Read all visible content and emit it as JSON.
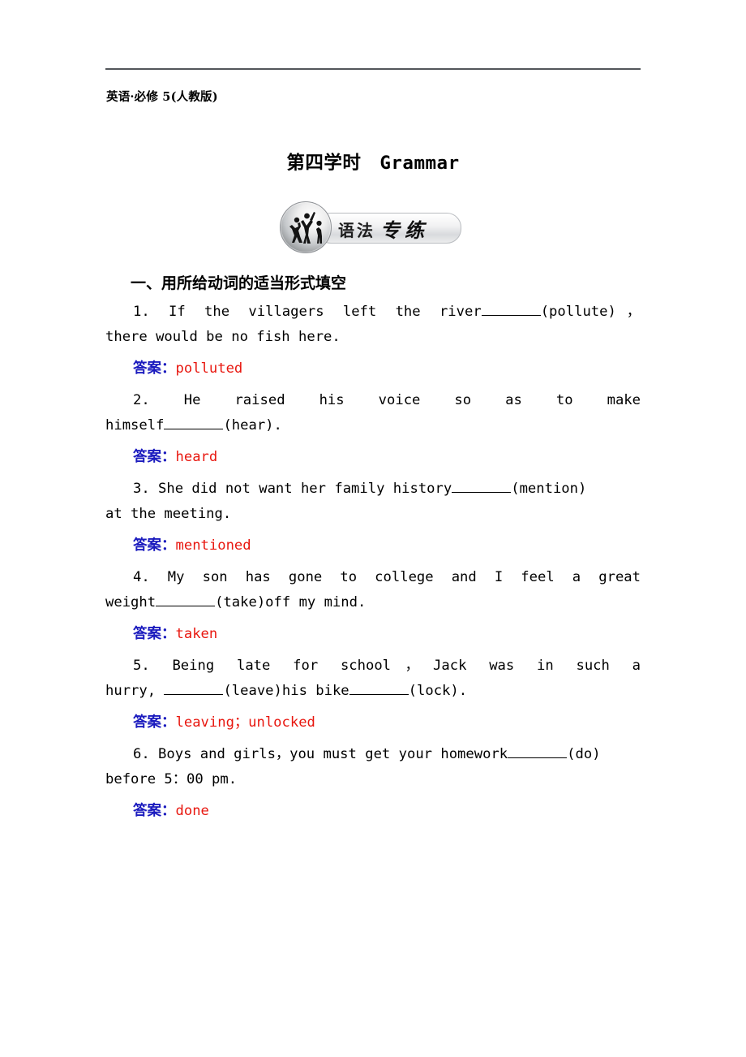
{
  "header": {
    "label": "英语·必修 5(人教版)",
    "rule": "horizontal-rule"
  },
  "title": "第四学时　Grammar",
  "banner": {
    "text_left": "语法",
    "text_right": "专练",
    "logo": "dancers-circle-logo"
  },
  "section": {
    "heading": "一、用所给动词的适当形式填空"
  },
  "colors": {
    "answer_label": "#1b1bbe",
    "answer_value": "#e8170f",
    "rule": "#53565a",
    "text": "#000000"
  },
  "questions": [
    {
      "number": "1.",
      "line1_pre": "1.  If  the  villagers  left  the  river",
      "line1_post": "(pollute)，",
      "line2": "there would be no fish here.",
      "justify": "wide",
      "answer_label": "答案：",
      "answer_value": "polluted"
    },
    {
      "number": "2.",
      "line1_pre": "2. He    raised    his    voice    so    as    to    make",
      "line1_post": "",
      "line2_pre": "himself",
      "line2_post": "(hear).",
      "line2_has_blank": true,
      "justify": "wide",
      "answer_label": "答案：",
      "answer_value": "heard"
    },
    {
      "number": "3.",
      "line1_pre": "3. She did not want her family history",
      "line1_post": "(mention)",
      "line2": "at the meeting.",
      "justify": "tight",
      "answer_label": "答案：",
      "answer_value": "mentioned"
    },
    {
      "number": "4.",
      "line1_pre": "4.  My  son  has  gone  to  college  and  I  feel  a  great",
      "line1_post": "",
      "line2_pre": "weight",
      "line2_post": "(take)off my mind.",
      "line2_has_blank": true,
      "justify": "wide",
      "answer_label": "答案：",
      "answer_value": "taken"
    },
    {
      "number": "5.",
      "line1_pre": "5.  Being  late  for  school，Jack  was  in  such  a",
      "line1_post": "",
      "line2_pre": "hurry, ",
      "line2_mid": "(leave)his bike",
      "line2_post": "(lock).",
      "line2_has_blank": true,
      "line2_two_blanks": true,
      "justify": "wide",
      "answer_label": "答案：",
      "answer_value": "leaving；unlocked"
    },
    {
      "number": "6.",
      "line1_pre": "6. Boys and girls，you must get your homework",
      "line1_post": "(do)",
      "line2": "before 5：00 pm.",
      "justify": "tight",
      "answer_label": "答案：",
      "answer_value": "done"
    }
  ]
}
